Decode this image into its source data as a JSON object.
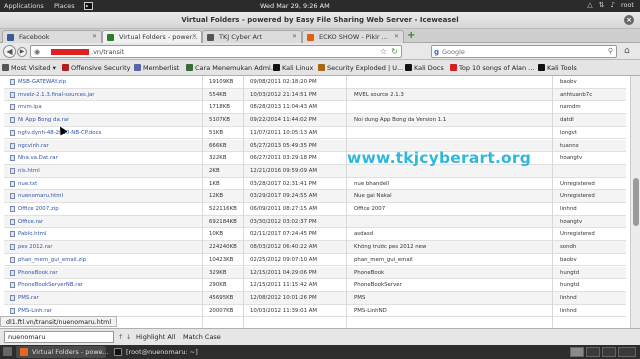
{
  "panel": {
    "applications": "Applications",
    "places": "Places",
    "clock": "Wed Mar 29,  9:26 AM",
    "user": "root"
  },
  "window": {
    "title": "Virtual Folders - powered by Easy File Sharing Web Server - Iceweasel"
  },
  "tabs": [
    {
      "label": "Facebook",
      "color": "#3b5998"
    },
    {
      "label": "Virtual Folders - power...",
      "color": "#2a7d2a"
    },
    {
      "label": "TKJ Cyber Art",
      "color": "#555555"
    },
    {
      "label": "ECKO SHOW - Pikir ...",
      "color": "#e06010"
    }
  ],
  "nav": {
    "url": ".vn/transit",
    "search_placeholder": "Google"
  },
  "bookmarks": [
    {
      "label": "Most Visited",
      "color": "#555555"
    },
    {
      "label": "Offensive Security",
      "color": "#b02020"
    },
    {
      "label": "Memberlist",
      "color": "#5566aa"
    },
    {
      "label": "Cara Menemukan Admi...",
      "color": "#3a6a3a"
    },
    {
      "label": "Kali Linux",
      "color": "#111111"
    },
    {
      "label": "Security Exploded | U...",
      "color": "#aa6611"
    },
    {
      "label": "Kali Docs",
      "color": "#111111"
    },
    {
      "label": "Top 10 songs of Alan ...",
      "color": "#d02020"
    },
    {
      "label": "Kali Tools",
      "color": "#111111"
    }
  ],
  "files": [
    {
      "name": "MSB-GATEWAY.zip",
      "size": "19109KB",
      "date": "09/08/2011 02:18:20 PM",
      "desc": "",
      "owner": "baobv"
    },
    {
      "name": "mvelz-2.1.3.final-sources.jar",
      "size": "554KB",
      "date": "10/03/2012 21:14:51 PM",
      "desc": "MVEL source 2.1.3",
      "owner": "anhtuanb7c"
    },
    {
      "name": "mvm.ipa",
      "size": "1718KB",
      "date": "08/28/2013 11:04:43 AM",
      "desc": "",
      "owner": "namdm"
    },
    {
      "name": "Ni App Bong da.rar",
      "size": "5107KB",
      "date": "09/22/2014 11:44:02 PM",
      "desc": "Noi dung App Bong da Version 1.1",
      "owner": "datdl"
    },
    {
      "name": "ngtv.dynh-48-2010-NB-CP.docs",
      "size": "51KB",
      "date": "11/07/2011 10:05:13 AM",
      "desc": "",
      "owner": "longvt"
    },
    {
      "name": "ngcvinh.rar",
      "size": "666KB",
      "date": "05/27/2013 05:49:35 PM",
      "desc": "",
      "owner": "tuannx"
    },
    {
      "name": "Nha.va.Dat.rar",
      "size": "322KB",
      "date": "06/27/2011 03:29:18 PM",
      "desc": "",
      "owner": "hoangtv"
    },
    {
      "name": "nls.html",
      "size": "2KB",
      "date": "12/21/2016 09:59:09 AM",
      "desc": "",
      "owner": ""
    },
    {
      "name": "nue.txt",
      "size": "1KB",
      "date": "03/28/2017 02:31:41 PM",
      "desc": "nue bhandell",
      "owner": "Unregistered"
    },
    {
      "name": "nuenomaru.html",
      "size": "12KB",
      "date": "03/29/2017 09:24:55 AM",
      "desc": "Nue gai Nakal",
      "owner": "Unregistered"
    },
    {
      "name": "Office 2007.zip",
      "size": "522116KB",
      "date": "06/09/2011 08:27:15 AM",
      "desc": "Office 2007",
      "owner": "linhnd"
    },
    {
      "name": "Office.rar",
      "size": "692184KB",
      "date": "03/30/2012 03:02:37 PM",
      "desc": "",
      "owner": "hoangtv"
    },
    {
      "name": "Pablo.html",
      "size": "10KB",
      "date": "02/11/2017 07:24:45 PM",
      "desc": "asdasd",
      "owner": "Unregistered"
    },
    {
      "name": "pes 2012.rar",
      "size": "224240KB",
      "date": "08/03/2012 06:40:22 AM",
      "desc": "Không trước pes 2012 new",
      "owner": "sondh"
    },
    {
      "name": "phan_mem_gui_email.zip",
      "size": "10423KB",
      "date": "02/25/2012 09:07:10 AM",
      "desc": "phan_mem_gui_email",
      "owner": "baobv"
    },
    {
      "name": "PhoneBook.rar",
      "size": "329KB",
      "date": "12/15/2011 04:29:06 PM",
      "desc": "PhoneBook",
      "owner": "hungtd"
    },
    {
      "name": "PhoneBookServerNB.rar",
      "size": "290KB",
      "date": "12/15/2011 11:15:42 AM",
      "desc": "PhoneBookServer",
      "owner": "hungtd"
    },
    {
      "name": "PMS.rar",
      "size": "45695KB",
      "date": "12/08/2012 10:01:26 PM",
      "desc": "PMS",
      "owner": "linhnd"
    },
    {
      "name": "PMS-Linh.rar",
      "size": "20007KB",
      "date": "10/03/2012 11:39:01 AM",
      "desc": "PMS-LinhND",
      "owner": "linhnd"
    }
  ],
  "watermark": "www.tkjcyberart.org",
  "status_url": "dl1.ftl.vn/transit/nuenomaru.html",
  "findbar": {
    "query": "nuenomaru",
    "highlight_all": "Highlight All",
    "match_case": "Match Case"
  },
  "taskbar": [
    {
      "label": "Virtual Folders - powe...",
      "color": "#e06a1a"
    },
    {
      "label": "[root@nuenomaru: ~]",
      "color": "#333333"
    }
  ]
}
